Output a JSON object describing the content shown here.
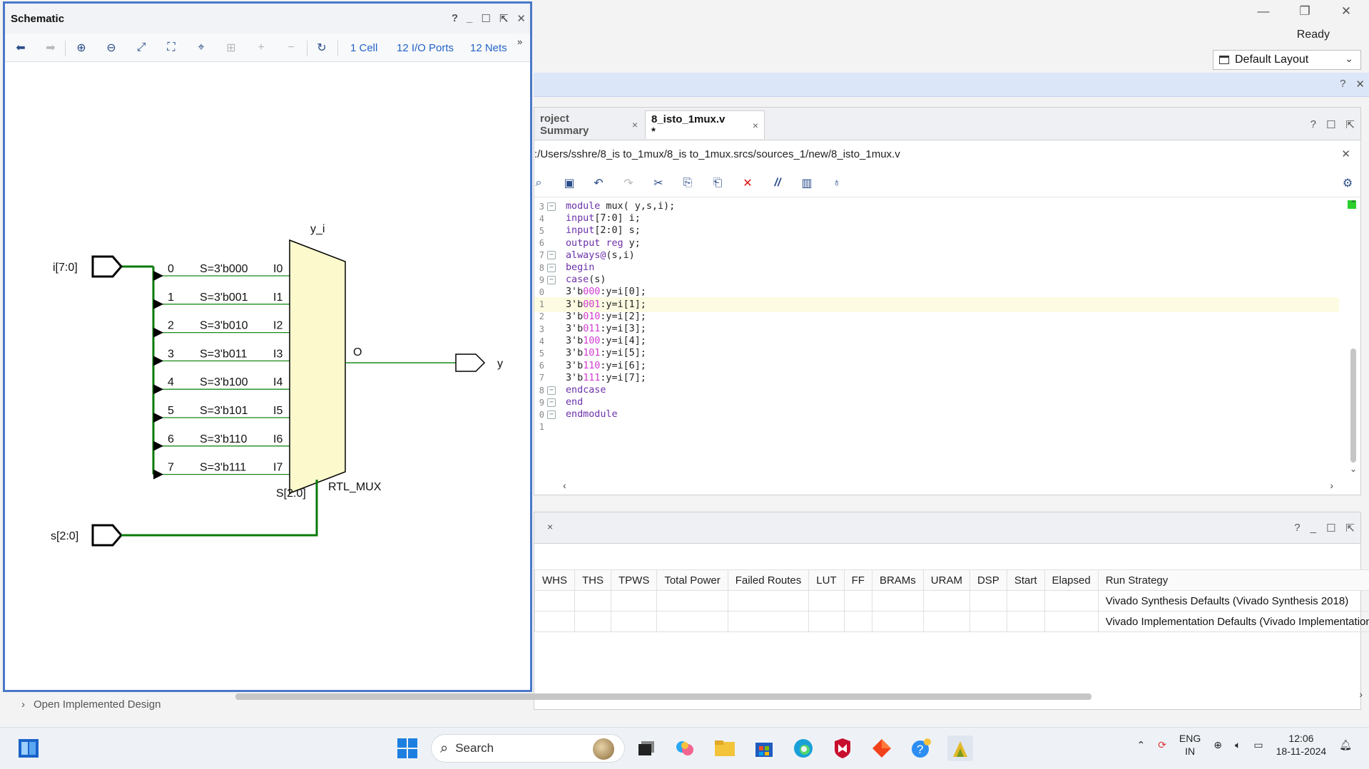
{
  "ide": {
    "window_controls": {
      "minimize": "—",
      "restore": "❐",
      "close": "✕"
    },
    "status": "Ready",
    "layout_selector": {
      "value": "Default Layout"
    },
    "editor": {
      "tabs": [
        {
          "label": "roject Summary",
          "close": "×"
        },
        {
          "label": "8_isto_1mux.v *",
          "close": "×"
        }
      ],
      "file_path": ":/Users/sshre/8_is to_1mux/8_is to_1mux.srcs/sources_1/new/8_isto_1mux.v",
      "code_lines": [
        {
          "ln": "3",
          "html": "<span class=\"kw\">module</span> mux( y,s,i);",
          "fold": true
        },
        {
          "ln": "4",
          "html": "<span class=\"kw\">input</span>[7:0] i;",
          "fold": false
        },
        {
          "ln": "5",
          "html": "<span class=\"kw\">input</span>[2:0] s;",
          "fold": false
        },
        {
          "ln": "6",
          "html": "<span class=\"kw\">output</span> <span class=\"kw\">reg</span> y;",
          "fold": false
        },
        {
          "ln": "7",
          "html": "<span class=\"kw\">always@</span>(s,i)",
          "fold": true
        },
        {
          "ln": "8",
          "html": "<span class=\"kw\">begin</span>",
          "fold": true
        },
        {
          "ln": "9",
          "html": "<span class=\"kw\">case</span>(s)",
          "fold": true
        },
        {
          "ln": "0",
          "html": "3'b<span class=\"num\">000</span>:y=i[0];",
          "fold": false
        },
        {
          "ln": "1",
          "html": "3'b<span class=\"num\">001</span>:y=i[1];",
          "fold": false,
          "highlight": true
        },
        {
          "ln": "2",
          "html": "3'b<span class=\"num\">010</span>:y=i[2];",
          "fold": false
        },
        {
          "ln": "3",
          "html": "3'b<span class=\"num\">011</span>:y=i[3];",
          "fold": false
        },
        {
          "ln": "4",
          "html": "3'b<span class=\"num\">100</span>:y=i[4];",
          "fold": false
        },
        {
          "ln": "5",
          "html": "3'b<span class=\"num\">101</span>:y=i[5];",
          "fold": false
        },
        {
          "ln": "6",
          "html": "3'b<span class=\"num\">110</span>:y=i[6];",
          "fold": false
        },
        {
          "ln": "7",
          "html": "3'b<span class=\"num\">111</span>:y=i[7];",
          "fold": false
        },
        {
          "ln": "8",
          "html": "<span class=\"kw\">endcase</span>",
          "fold": true
        },
        {
          "ln": "9",
          "html": "<span class=\"kw\">end</span>",
          "fold": true
        },
        {
          "ln": "0",
          "html": "<span class=\"kw\">endmodule</span>",
          "fold": true
        },
        {
          "ln": "1",
          "html": "",
          "fold": false
        }
      ]
    },
    "runs": {
      "columns": [
        "WHS",
        "THS",
        "TPWS",
        "Total Power",
        "Failed Routes",
        "LUT",
        "FF",
        "BRAMs",
        "URAM",
        "DSP",
        "Start",
        "Elapsed",
        "Run Strategy"
      ],
      "rows": [
        [
          "",
          "",
          "",
          "",
          "",
          "",
          "",
          "",
          "",
          "",
          "",
          "",
          "Vivado Synthesis Defaults (Vivado Synthesis 2018)"
        ],
        [
          "",
          "",
          "",
          "",
          "",
          "",
          "",
          "",
          "",
          "",
          "",
          "",
          "Vivado Implementation Defaults (Vivado Implementation"
        ]
      ]
    },
    "flow_item": "Open Implemented Design"
  },
  "schematic": {
    "title": "Schematic",
    "links": {
      "cells": "1 Cell",
      "ports": "12 I/O Ports",
      "nets": "12 Nets"
    },
    "more": "»",
    "ports": {
      "input_i": "i[7:0]",
      "input_s": "s[2:0]",
      "output_y": "y"
    },
    "mux": {
      "instance": "y_i",
      "type": "RTL_MUX",
      "output_pin": "O",
      "select_pin": "S[2:0]",
      "inputs": [
        {
          "bit": "0",
          "cond": "S=3'b000",
          "pin": "I0"
        },
        {
          "bit": "1",
          "cond": "S=3'b001",
          "pin": "I1"
        },
        {
          "bit": "2",
          "cond": "S=3'b010",
          "pin": "I2"
        },
        {
          "bit": "3",
          "cond": "S=3'b011",
          "pin": "I3"
        },
        {
          "bit": "4",
          "cond": "S=3'b100",
          "pin": "I4"
        },
        {
          "bit": "5",
          "cond": "S=3'b101",
          "pin": "I5"
        },
        {
          "bit": "6",
          "cond": "S=3'b110",
          "pin": "I6"
        },
        {
          "bit": "7",
          "cond": "S=3'b111",
          "pin": "I7"
        }
      ],
      "colors": {
        "net": "#1a8a1a",
        "bus": "#0a7a0a",
        "mux_fill": "#fcfacd"
      }
    }
  },
  "taskbar": {
    "search_placeholder": "Search",
    "language": {
      "line1": "ENG",
      "line2": "IN"
    },
    "clock": {
      "time": "12:06",
      "date": "18-11-2024"
    }
  }
}
